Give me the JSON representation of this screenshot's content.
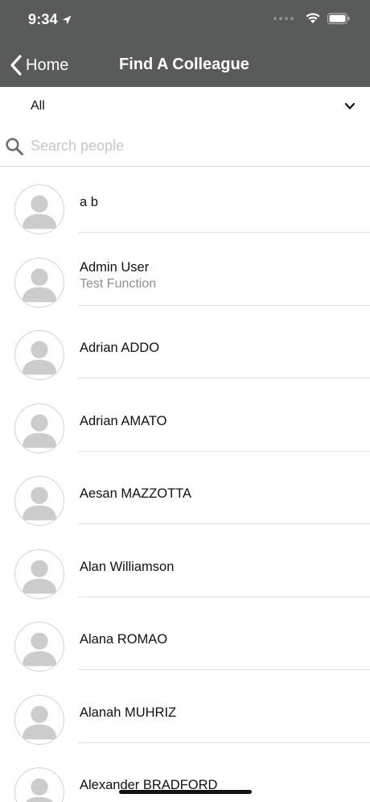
{
  "status_bar": {
    "time": "9:34",
    "icons": [
      "location-arrow-icon",
      "signal-icon",
      "wifi-icon",
      "battery-icon"
    ]
  },
  "nav": {
    "back_label": "Home",
    "back_icon": "chevron-left-icon",
    "title": "Find A Colleague"
  },
  "filter": {
    "selected": "All",
    "icon": "chevron-down-icon"
  },
  "search": {
    "placeholder": "Search people",
    "value": "",
    "icon": "search-icon"
  },
  "people": [
    {
      "name": "a b",
      "subtitle": ""
    },
    {
      "name": "Admin User",
      "subtitle": "Test Function"
    },
    {
      "name": "Adrian ADDO",
      "subtitle": ""
    },
    {
      "name": "Adrian AMATO",
      "subtitle": ""
    },
    {
      "name": "Aesan MAZZOTTA",
      "subtitle": ""
    },
    {
      "name": "Alan Williamson",
      "subtitle": ""
    },
    {
      "name": "Alana ROMAO",
      "subtitle": ""
    },
    {
      "name": "Alanah MUHRIZ",
      "subtitle": ""
    },
    {
      "name": "Alexander BRADFORD",
      "subtitle": ""
    }
  ],
  "colors": {
    "nav_background": "#585b5a",
    "avatar_fill": "#cccccc",
    "placeholder": "#c7c7cc",
    "subtitle": "#8e8e93"
  }
}
